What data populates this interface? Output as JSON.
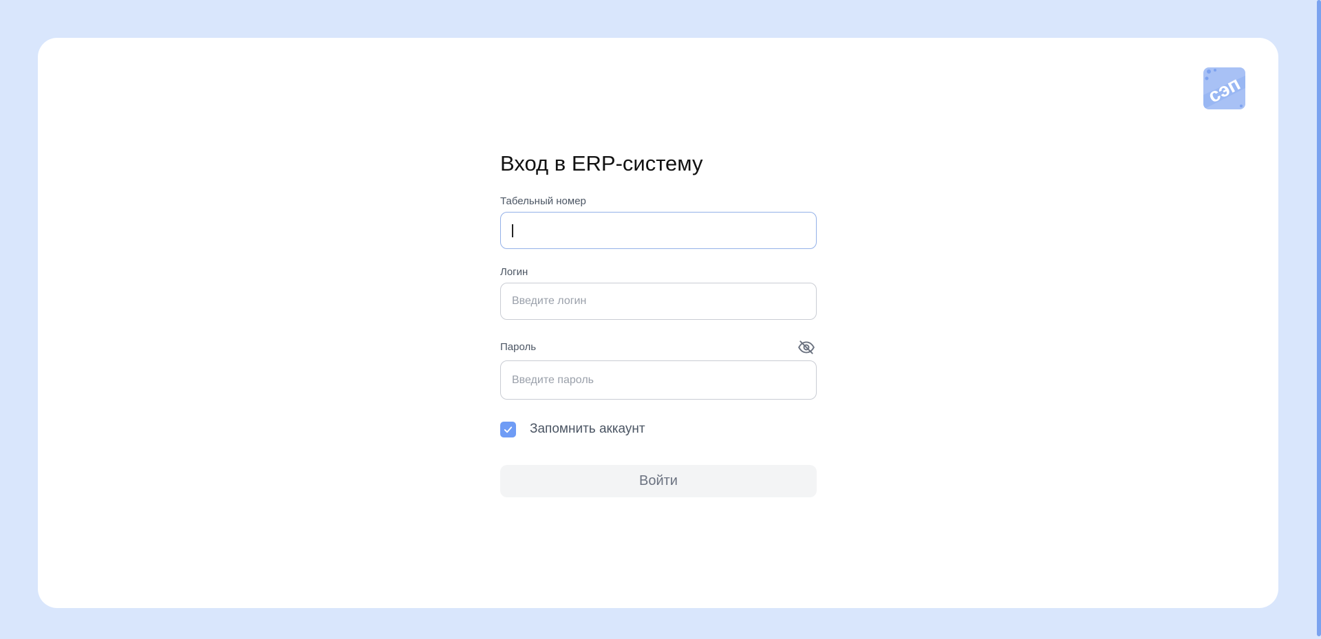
{
  "form": {
    "title": "Вход в ERP-систему",
    "tab_number": {
      "label": "Табельный номер",
      "value": "",
      "placeholder": ""
    },
    "login": {
      "label": "Логин",
      "value": "",
      "placeholder": "Введите логин"
    },
    "password": {
      "label": "Пароль",
      "value": "",
      "placeholder": "Введите пароль",
      "visibility_icon": "eye-off-icon"
    },
    "remember": {
      "label": "Запомнить аккаунт",
      "checked": true
    },
    "submit_label": "Войти"
  },
  "logo": {
    "icon": "cep-logo"
  },
  "colors": {
    "page_background": "#d9e6fc",
    "card_background": "#ffffff",
    "accent": "#6f9cf5",
    "scrollbar": "#7aa2ef"
  }
}
